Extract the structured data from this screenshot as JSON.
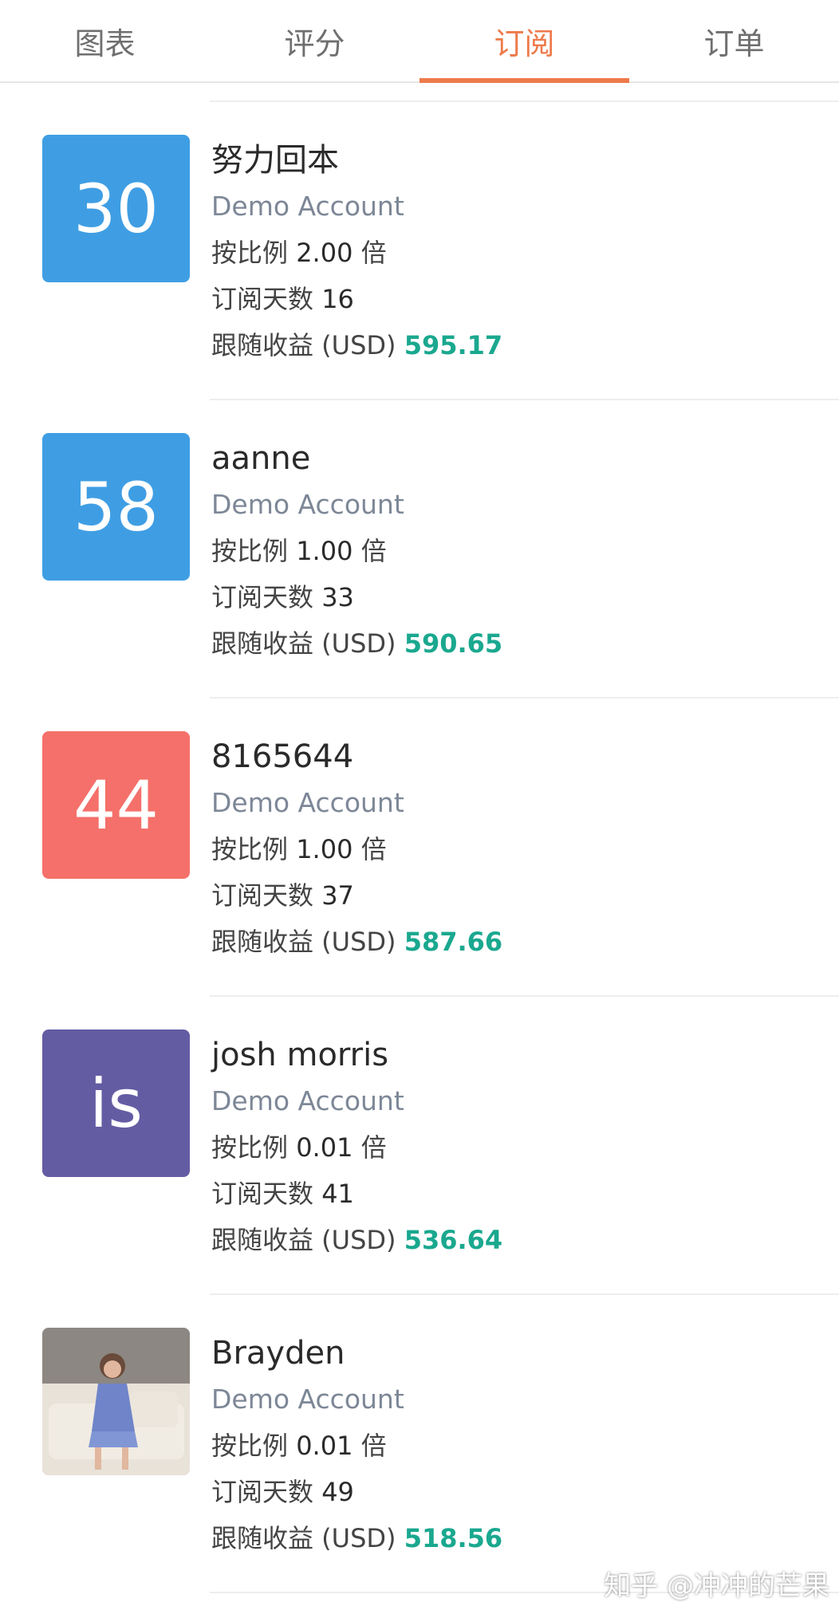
{
  "tabs": [
    {
      "label": "图表",
      "active": false
    },
    {
      "label": "评分",
      "active": false
    },
    {
      "label": "订阅",
      "active": true
    },
    {
      "label": "订单",
      "active": false
    }
  ],
  "accent_color": "#ee7a4b",
  "profit_color": "#1aa88f",
  "labels": {
    "ratio": "按比例",
    "ratio_unit": "倍",
    "days": "订阅天数",
    "profit": "跟随收益 (USD)"
  },
  "subscriptions": [
    {
      "avatar_text": "30",
      "avatar_color": "#3f9ee3",
      "name": "努力回本",
      "account": "Demo Account",
      "ratio": "2.00",
      "days": "16",
      "profit": "595.17"
    },
    {
      "avatar_text": "58",
      "avatar_color": "#3f9ee3",
      "name": "aanne",
      "account": "Demo Account",
      "ratio": "1.00",
      "days": "33",
      "profit": "590.65"
    },
    {
      "avatar_text": "44",
      "avatar_color": "#f5706a",
      "name": "8165644",
      "account": "Demo Account",
      "ratio": "1.00",
      "days": "37",
      "profit": "587.66"
    },
    {
      "avatar_text": "is",
      "avatar_color": "#645ca3",
      "name": "josh morris",
      "account": "Demo Account",
      "ratio": "0.01",
      "days": "41",
      "profit": "536.64"
    },
    {
      "avatar_text": "",
      "avatar_color": "",
      "avatar_icon": "user-photo",
      "name": "Brayden",
      "account": "Demo Account",
      "ratio": "0.01",
      "days": "49",
      "profit": "518.56"
    }
  ],
  "watermark": "知乎 @冲冲的芒果"
}
